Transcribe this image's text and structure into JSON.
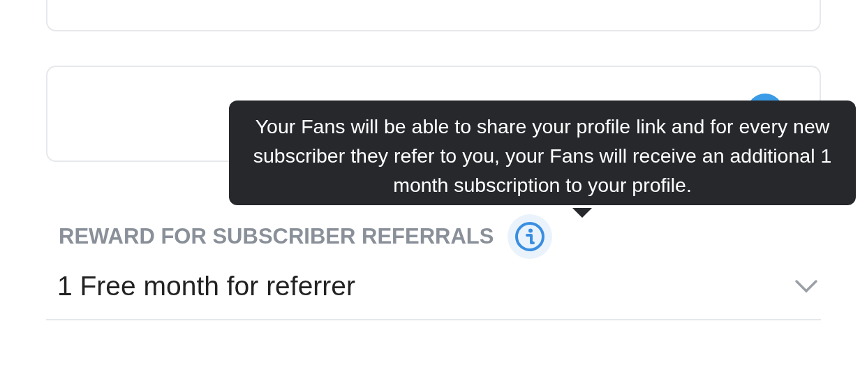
{
  "tooltip": {
    "text": "Your Fans will be able to share your profile link and for every new subscriber they refer to you, your Fans will receive an additional 1 month subscription to your profile."
  },
  "reward_field": {
    "label": "REWARD FOR SUBSCRIBER REFERRALS",
    "value": "1 Free month for referrer"
  }
}
